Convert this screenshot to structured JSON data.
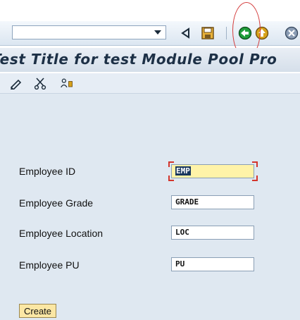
{
  "toolbar": {
    "command_field_value": "",
    "icons": [
      "dropdown-icon",
      "enter-icon",
      "save-icon",
      "back-icon",
      "exit-icon",
      "cancel-icon"
    ]
  },
  "titlebar": {
    "title": "Test Title for test Module Pool Pro"
  },
  "app_toolbar": {
    "icons": [
      "pencil-icon",
      "scissors-icon",
      "user-key-icon"
    ]
  },
  "form": {
    "employee_id": {
      "label": "Employee ID",
      "value": "EMP"
    },
    "employee_grade": {
      "label": "Employee Grade",
      "value": "GRADE"
    },
    "employee_location": {
      "label": "Employee Location",
      "value": "LOC"
    },
    "employee_pu": {
      "label": "Employee PU",
      "value": "PU"
    }
  },
  "buttons": {
    "create": "Create"
  },
  "colors": {
    "annotation": "#d43c3c",
    "active_field": "#fff3a8",
    "button": "#fbe7a4",
    "back_icon": "#1f9d3a",
    "exit_icon": "#d7a21a"
  }
}
